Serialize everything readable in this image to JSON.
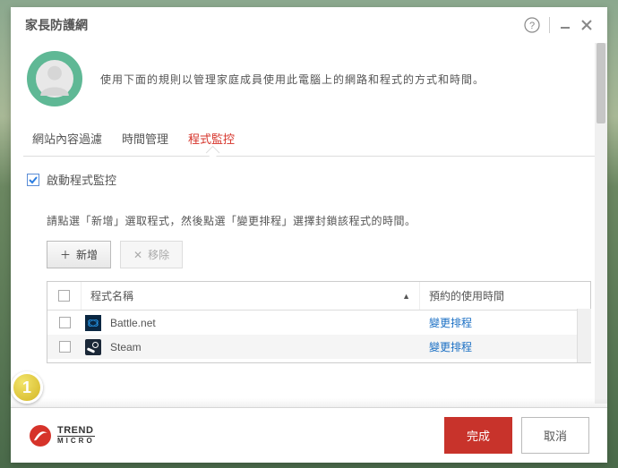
{
  "window": {
    "title": "家長防護網"
  },
  "header": {
    "description": "使用下面的規則以管理家庭成員使用此電腦上的網路和程式的方式和時間。"
  },
  "tabs": [
    {
      "label": "網站內容過濾",
      "active": false
    },
    {
      "label": "時間管理",
      "active": false
    },
    {
      "label": "程式監控",
      "active": true
    }
  ],
  "enable": {
    "label": "啟動程式監控",
    "checked": true
  },
  "instruction": "請點選「新增」選取程式，然後點選「變更排程」選擇封鎖該程式的時間。",
  "buttons": {
    "add": {
      "icon": "＋",
      "label": "新增"
    },
    "remove": {
      "icon": "✕",
      "label": "移除"
    }
  },
  "table": {
    "headers": {
      "name": "程式名稱",
      "time": "預約的使用時間"
    },
    "rows": [
      {
        "icon": "bnet",
        "name": "Battle.net",
        "action": "變更排程"
      },
      {
        "icon": "steam",
        "name": "Steam",
        "action": "變更排程"
      }
    ]
  },
  "step": {
    "number": "1"
  },
  "footer": {
    "brand_top": "TREND",
    "brand_bottom": "MICRO",
    "ok": "完成",
    "cancel": "取消"
  }
}
